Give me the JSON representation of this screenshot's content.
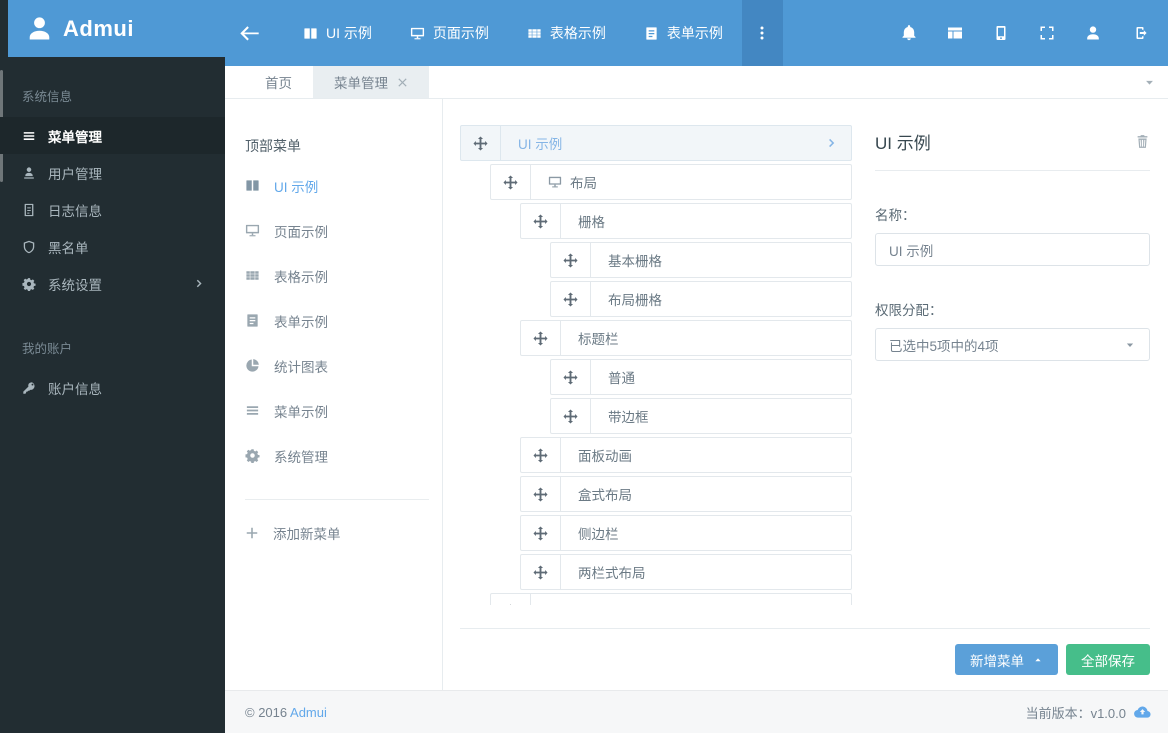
{
  "brand": {
    "name": "Admui",
    "logo_icon": "user"
  },
  "navbar": {
    "items": [
      {
        "label": "UI 示例",
        "icon": "book"
      },
      {
        "label": "页面示例",
        "icon": "monitor"
      },
      {
        "label": "表格示例",
        "icon": "table"
      },
      {
        "label": "表单示例",
        "icon": "form"
      }
    ],
    "right_icons": [
      {
        "name": "notifications-button",
        "icon": "bell"
      },
      {
        "name": "layout-button",
        "icon": "layout"
      },
      {
        "name": "mobile-button",
        "icon": "mobile"
      },
      {
        "name": "fullscreen-button",
        "icon": "fullscreen"
      },
      {
        "name": "user-button",
        "icon": "user"
      },
      {
        "name": "logout-button",
        "icon": "logout"
      }
    ]
  },
  "sidebar": {
    "sections": [
      {
        "title": "系统信息",
        "items": [
          {
            "label": "菜单管理",
            "icon": "list",
            "active": true,
            "name": "menu-management"
          },
          {
            "label": "用户管理",
            "icon": "user-desk",
            "name": "user-management"
          },
          {
            "label": "日志信息",
            "icon": "file",
            "name": "log-info"
          },
          {
            "label": "黑名单",
            "icon": "shield",
            "name": "blacklist"
          },
          {
            "label": "系统设置",
            "icon": "gear",
            "children": true,
            "name": "system-settings"
          }
        ]
      },
      {
        "title": "我的账户",
        "items": [
          {
            "label": "账户信息",
            "icon": "key",
            "name": "account-info"
          }
        ]
      }
    ]
  },
  "tabs": [
    {
      "label": "首页",
      "name": "home"
    },
    {
      "label": "菜单管理",
      "closable": true,
      "active": true,
      "name": "menu-management"
    }
  ],
  "menu_panel": {
    "title": "顶部菜单",
    "items": [
      {
        "label": "UI 示例",
        "icon": "book",
        "active": true,
        "name": "ui-demo"
      },
      {
        "label": "页面示例",
        "icon": "monitor",
        "name": "page-demo"
      },
      {
        "label": "表格示例",
        "icon": "table",
        "name": "table-demo"
      },
      {
        "label": "表单示例",
        "icon": "form",
        "name": "form-demo"
      },
      {
        "label": "统计图表",
        "icon": "pie",
        "name": "charts"
      },
      {
        "label": "菜单示例",
        "icon": "list",
        "name": "menu-demo"
      },
      {
        "label": "系统管理",
        "icon": "gear",
        "name": "system-admin"
      }
    ],
    "add_label": "添加新菜单"
  },
  "tree": {
    "rows": [
      {
        "label": "UI 示例",
        "level": 0,
        "selected": true,
        "chevron": true
      },
      {
        "label": "布局",
        "level": 1,
        "icon": "monitor"
      },
      {
        "label": "栅格",
        "level": 2
      },
      {
        "label": "基本栅格",
        "level": 3
      },
      {
        "label": "布局栅格",
        "level": 3
      },
      {
        "label": "标题栏",
        "level": 2
      },
      {
        "label": "普通",
        "level": 3
      },
      {
        "label": "带边框",
        "level": 3
      },
      {
        "label": "面板动画",
        "level": 2
      },
      {
        "label": "盒式布局",
        "level": 2
      },
      {
        "label": "侧边栏",
        "level": 2
      },
      {
        "label": "两栏式布局",
        "level": 2
      },
      {
        "label": "",
        "level": 1,
        "clipped": true
      }
    ]
  },
  "detail": {
    "title": "UI 示例",
    "name_label": "名称：",
    "name_value": "UI 示例",
    "perm_label": "权限分配：",
    "perm_value": "已选中5项中的4项"
  },
  "actions": {
    "add": "新增菜单",
    "save": "全部保存"
  },
  "footer": {
    "copyright": "© 2016",
    "brand_link": "Admui",
    "version": "当前版本：v1.0.0"
  },
  "colors": {
    "navbar": "#4f99d5",
    "navbar_more": "#4387c2",
    "sidebar": "#222d32",
    "sidebar_active": "#1d272b",
    "accent": "#62a8ea",
    "primary_button": "#5ba0d9",
    "success_button": "#46be8a",
    "text": "#76838f",
    "border": "#e7ecef",
    "selected_row_bg": "#f2f6f9",
    "selected_row_text": "#85b5e6"
  }
}
